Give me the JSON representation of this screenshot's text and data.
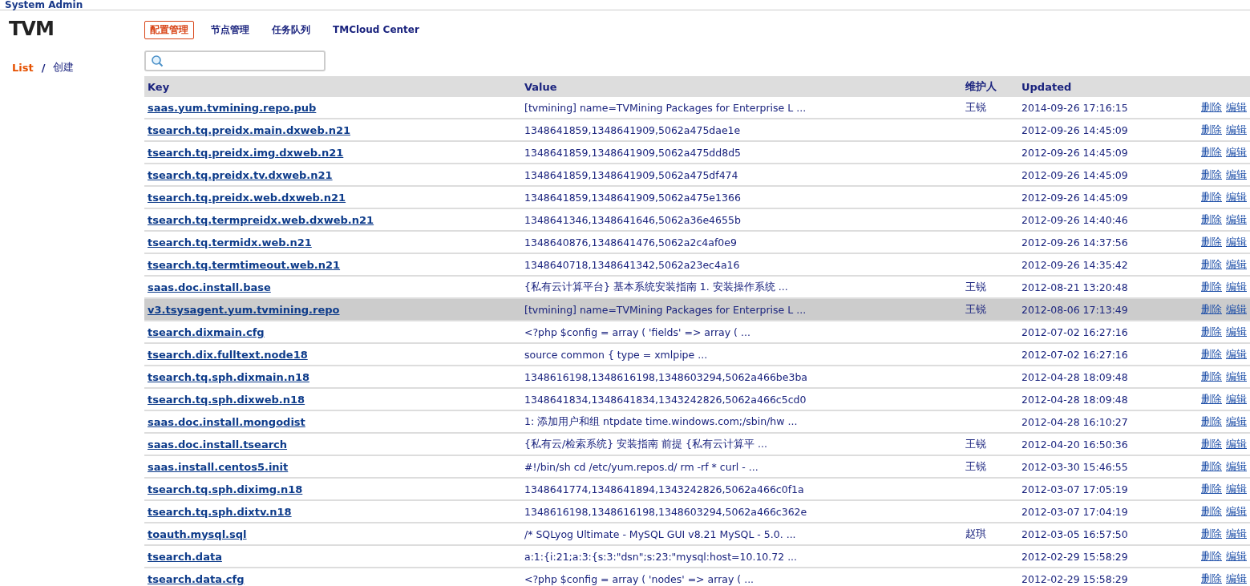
{
  "window": {
    "title": "System Admin"
  },
  "logo": {
    "text": "TVM"
  },
  "nav": [
    {
      "label": "配置管理",
      "selected": true
    },
    {
      "label": "节点管理",
      "selected": false
    },
    {
      "label": "任务队列",
      "selected": false
    },
    {
      "label": "TMCloud Center",
      "selected": false
    }
  ],
  "breadcrumb": [
    {
      "label": "List",
      "selected": true
    },
    {
      "label": "创建",
      "selected": false
    }
  ],
  "breadcrumb_separator": "/",
  "table": {
    "columns": [
      "Key",
      "Value",
      "维护人",
      "Updated"
    ],
    "rows": [
      {
        "key": "saas.yum.tvmining.repo.pub",
        "value": "[tvmining] name=TVMining Packages for Enterprise L ...",
        "maintainer": "王锐",
        "updated": "2014-09-26 17:16:15",
        "actions": [
          "删除",
          "编辑"
        ],
        "selected": false
      },
      {
        "key": "tsearch.tq.preidx.main.dxweb.n21",
        "value": "1348641859,1348641909,5062a475dae1e",
        "updated": "2012-09-26 14:45:09",
        "actions": [
          "删除",
          "编辑"
        ],
        "selected": false
      },
      {
        "key": "tsearch.tq.preidx.img.dxweb.n21",
        "value": "1348641859,1348641909,5062a475dd8d5",
        "updated": "2012-09-26 14:45:09",
        "actions": [
          "删除",
          "编辑"
        ],
        "selected": false
      },
      {
        "key": "tsearch.tq.preidx.tv.dxweb.n21",
        "value": "1348641859,1348641909,5062a475df474",
        "updated": "2012-09-26 14:45:09",
        "actions": [
          "删除",
          "编辑"
        ],
        "selected": false
      },
      {
        "key": "tsearch.tq.preidx.web.dxweb.n21",
        "value": "1348641859,1348641909,5062a475e1366",
        "updated": "2012-09-26 14:45:09",
        "actions": [
          "删除",
          "编辑"
        ],
        "selected": false
      },
      {
        "key": "tsearch.tq.termpreidx.web.dxweb.n21",
        "value": "1348641346,1348641646,5062a36e4655b",
        "updated": "2012-09-26 14:40:46",
        "actions": [
          "删除",
          "编辑"
        ],
        "selected": false
      },
      {
        "key": "tsearch.tq.termidx.web.n21",
        "value": "1348640876,1348641476,5062a2c4af0e9",
        "updated": "2012-09-26 14:37:56",
        "actions": [
          "删除",
          "编辑"
        ],
        "selected": false
      },
      {
        "key": "tsearch.tq.termtimeout.web.n21",
        "value": "1348640718,1348641342,5062a23ec4a16",
        "updated": "2012-09-26 14:35:42",
        "actions": [
          "删除",
          "编辑"
        ],
        "selected": false
      },
      {
        "key": "saas.doc.install.base",
        "value": "{私有云计算平台} 基本系统安装指南 1. 安装操作系统 ...",
        "maintainer": "王锐",
        "updated": "2012-08-21 13:20:48",
        "actions": [
          "删除",
          "编辑"
        ],
        "selected": false
      },
      {
        "key": "v3.tsysagent.yum.tvmining.repo",
        "value": "[tvmining] name=TVMining Packages for Enterprise L ...",
        "maintainer": "王锐",
        "updated": "2012-08-06 17:13:49",
        "actions": [
          "删除",
          "编辑"
        ],
        "selected": true
      },
      {
        "key": "tsearch.dixmain.cfg",
        "value": "<?php $config = array ( 'fields' => array ( ...",
        "updated": "2012-07-02 16:27:16",
        "actions": [
          "删除",
          "编辑"
        ],
        "selected": false
      },
      {
        "key": "tsearch.dix.fulltext.node18",
        "value": "source common { type = xmlpipe ...",
        "updated": "2012-07-02 16:27:16",
        "actions": [
          "删除",
          "编辑"
        ],
        "selected": false
      },
      {
        "key": "tsearch.tq.sph.dixmain.n18",
        "value": "1348616198,1348616198,1348603294,5062a466be3ba",
        "updated": "2012-04-28 18:09:48",
        "actions": [
          "删除",
          "编辑"
        ],
        "selected": false
      },
      {
        "key": "tsearch.tq.sph.dixweb.n18",
        "value": "1348641834,1348641834,1343242826,5062a466c5cd0",
        "updated": "2012-04-28 18:09:48",
        "actions": [
          "删除",
          "编辑"
        ],
        "selected": false
      },
      {
        "key": "saas.doc.install.mongodist",
        "value": "1: 添加用户和组 ntpdate time.windows.com;/sbin/hw ...",
        "updated": "2012-04-28 16:10:27",
        "actions": [
          "删除",
          "编辑"
        ],
        "selected": false
      },
      {
        "key": "saas.doc.install.tsearch",
        "value": "{私有云/检索系统} 安装指南 前提 {私有云计算平 ...",
        "maintainer": "王锐",
        "updated": "2012-04-20 16:50:36",
        "actions": [
          "删除",
          "编辑"
        ],
        "selected": false
      },
      {
        "key": "saas.install.centos5.init",
        "value": "#!/bin/sh cd /etc/yum.repos.d/ rm -rf * curl - ...",
        "maintainer": "王锐",
        "updated": "2012-03-30 15:46:55",
        "actions": [
          "删除",
          "编辑"
        ],
        "selected": false
      },
      {
        "key": "tsearch.tq.sph.diximg.n18",
        "value": "1348641774,1348641894,1343242826,5062a466c0f1a",
        "updated": "2012-03-07 17:05:19",
        "actions": [
          "删除",
          "编辑"
        ],
        "selected": false
      },
      {
        "key": "tsearch.tq.sph.dixtv.n18",
        "value": "1348616198,1348616198,1348603294,5062a466c362e",
        "updated": "2012-03-07 17:04:19",
        "actions": [
          "删除",
          "编辑"
        ],
        "selected": false
      },
      {
        "key": "toauth.mysql.sql",
        "value": "/* SQLyog Ultimate - MySQL GUI v8.21 MySQL - 5.0. ...",
        "maintainer": "赵琪",
        "updated": "2012-03-05 16:57:50",
        "actions": [
          "删除",
          "编辑"
        ],
        "selected": false
      },
      {
        "key": "tsearch.data",
        "value": "a:1:{i:21;a:3:{s:3:\"dsn\";s:23:\"mysql:host=10.10.72 ...",
        "updated": "2012-02-29 15:58:29",
        "actions": [
          "删除",
          "编辑"
        ],
        "selected": false
      },
      {
        "key": "tsearch.data.cfg",
        "value": "<?php $config = array ( 'nodes' => array ( ...",
        "updated": "2012-02-29 15:58:29",
        "actions": [
          "删除",
          "编辑"
        ],
        "selected": false
      }
    ]
  }
}
